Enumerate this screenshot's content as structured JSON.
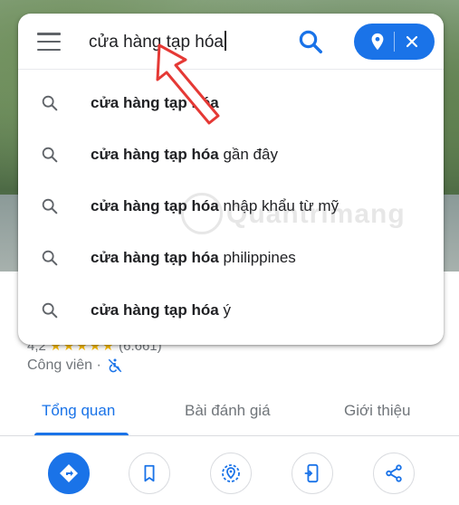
{
  "search": {
    "query": "cửa hàng tạp hóa"
  },
  "suggestions": [
    {
      "bold": "cửa hàng tạp hóa",
      "rest": ""
    },
    {
      "bold": "cửa hàng tạp hóa",
      "rest": " gần đây"
    },
    {
      "bold": "cửa hàng tạp hóa",
      "rest": " nhập khẩu từ mỹ"
    },
    {
      "bold": "cửa hàng tạp hóa",
      "rest": " philippines"
    },
    {
      "bold": "cửa hàng tạp hóa",
      "rest": " ý"
    }
  ],
  "place": {
    "rating": "4,2",
    "stars": "★★★★★",
    "reviews": "(6.661)",
    "category": "Công viên ·"
  },
  "tabs": {
    "overview": "Tổng quan",
    "reviews": "Bài đánh giá",
    "about": "Giới thiệu"
  },
  "watermark": "Quantrimang",
  "colors": {
    "accent": "#1a73e8",
    "arrow": "#e53935",
    "star": "#fbbc04"
  },
  "icons": [
    "menu-icon",
    "search-icon",
    "location-pin-icon",
    "close-icon",
    "directions-icon",
    "bookmark-icon",
    "nearby-icon",
    "send-to-phone-icon",
    "share-icon",
    "no-wheelchair-icon"
  ]
}
